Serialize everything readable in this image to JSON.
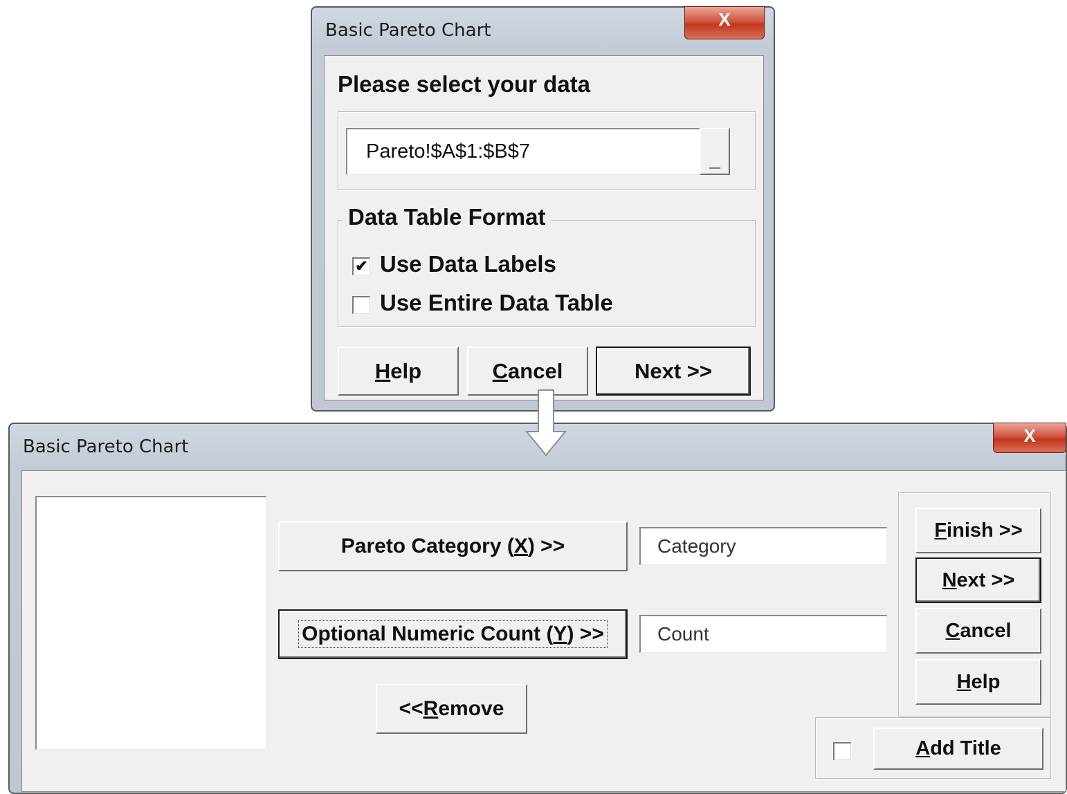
{
  "dialog1": {
    "title": "Basic Pareto Chart",
    "close_label": "X",
    "prompt": "Please select your data",
    "range_value": "Pareto!$A$1:$B$7",
    "range_button_label": "_",
    "format_group_title": "Data Table Format",
    "use_data_labels": {
      "label": "Use Data Labels",
      "checked": true,
      "mark": "✔"
    },
    "use_entire_table": {
      "label": "Use Entire Data Table",
      "checked": false
    },
    "help": {
      "accel": "H",
      "rest": "elp"
    },
    "cancel": {
      "accel": "C",
      "rest": "ancel"
    },
    "next_label": "Next >>"
  },
  "arrow": {
    "icon": "down-arrow-icon"
  },
  "dialog2": {
    "title": "Basic Pareto Chart",
    "close_label": "X",
    "category_button": {
      "pre": "Pareto Category (",
      "accel": "X",
      "post": ") >>"
    },
    "count_button": {
      "pre": "Optional Numeric Count (",
      "accel": "Y",
      "post": ") >>"
    },
    "category_value": "Category",
    "count_value": "Count",
    "remove_button": {
      "pre": "<< ",
      "accel": "R",
      "post": "emove"
    },
    "finish": {
      "accel": "F",
      "post": "inish >>"
    },
    "next": {
      "accel": "N",
      "post": "ext >>"
    },
    "cancel": {
      "accel": "C",
      "post": "ancel"
    },
    "help": {
      "accel": "H",
      "post": "elp"
    },
    "add_title": {
      "accel": "A",
      "post": "dd Title",
      "checked": false
    }
  }
}
